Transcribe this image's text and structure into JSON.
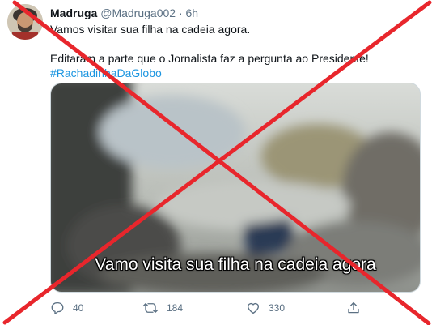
{
  "user": {
    "name": "Madruga",
    "handle": "@Madruga002",
    "separator": "·",
    "time": "6h"
  },
  "tweet": {
    "line1": "Vamos visitar sua filha na cadeia agora.",
    "line2": "Editaram a parte que o Jornalista faz a pergunta ao Presidente!",
    "hashtag": "#RachadinhaDaGlobo"
  },
  "media": {
    "subtitle": "Vamo visita sua filha na cadeia agora"
  },
  "actions": {
    "reply_count": "40",
    "retweet_count": "184",
    "like_count": "330"
  },
  "icons": {
    "reply": "reply-icon",
    "retweet": "retweet-icon",
    "like": "heart-icon",
    "share": "share-icon"
  },
  "colors": {
    "link": "#1b95e0",
    "muted": "#5b7083",
    "overlay_x": "#e8262c"
  }
}
